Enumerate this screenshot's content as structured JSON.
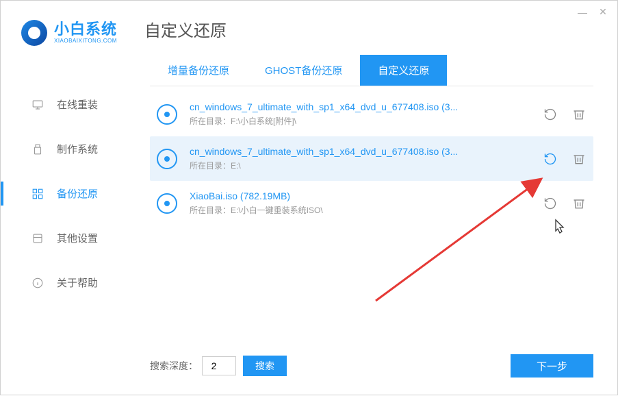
{
  "brand": {
    "title": "小白系统",
    "subtitle": "XIAOBAIXITONG.COM"
  },
  "page_title": "自定义还原",
  "window": {
    "minimize": "—",
    "close": "✕"
  },
  "sidebar": {
    "items": [
      {
        "label": "在线重装",
        "icon": "monitor"
      },
      {
        "label": "制作系统",
        "icon": "usb"
      },
      {
        "label": "备份还原",
        "icon": "grid",
        "active": true
      },
      {
        "label": "其他设置",
        "icon": "settings"
      },
      {
        "label": "关于帮助",
        "icon": "info"
      }
    ]
  },
  "tabs": [
    {
      "label": "增量备份还原"
    },
    {
      "label": "GHOST备份还原"
    },
    {
      "label": "自定义还原",
      "active": true
    }
  ],
  "list": [
    {
      "title": "cn_windows_7_ultimate_with_sp1_x64_dvd_u_677408.iso (3...",
      "path": "所在目录：F:\\小白系统[附件]\\",
      "highlighted": false
    },
    {
      "title": "cn_windows_7_ultimate_with_sp1_x64_dvd_u_677408.iso (3...",
      "path": "所在目录：E:\\",
      "highlighted": true
    },
    {
      "title": "XiaoBai.iso (782.19MB)",
      "path": "所在目录：E:\\小白一键重装系统ISO\\",
      "highlighted": false
    }
  ],
  "footer": {
    "search_label": "搜索深度：",
    "depth_value": "2",
    "search_btn": "搜索",
    "next_btn": "下一步"
  }
}
